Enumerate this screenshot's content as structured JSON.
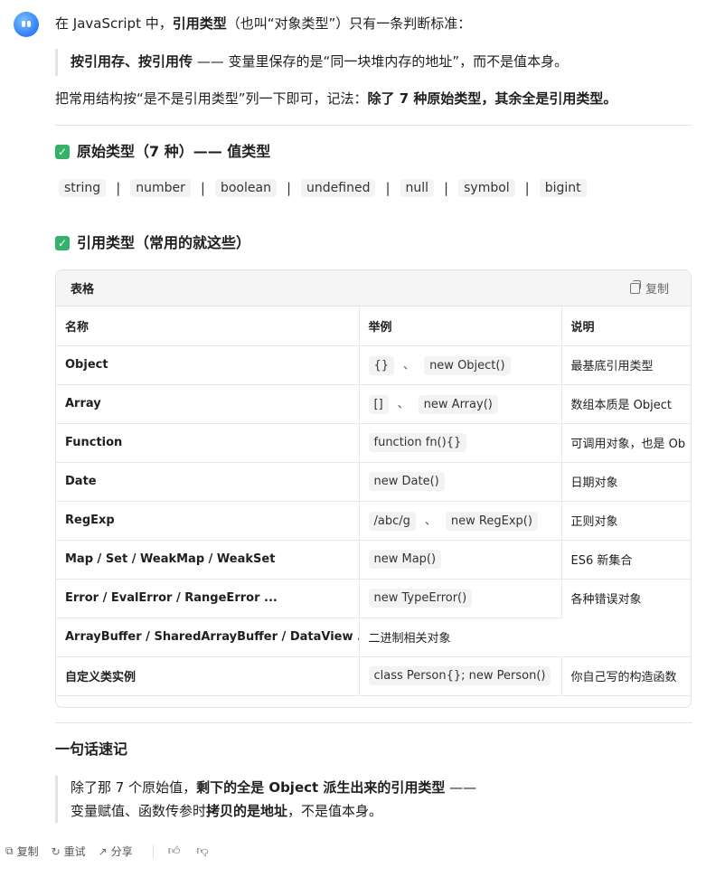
{
  "intro": {
    "prefix": "在 JavaScript 中，",
    "bold": "引用类型",
    "suffix": "（也叫“对象类型”）只有一条判断标准："
  },
  "quote1": {
    "bold": "按引用存、按引用传",
    "text": " —— 变量里保存的是“同一块堆内存的地址”，而不是值本身。"
  },
  "para2": {
    "prefix": "把常用结构按“是不是引用类型”列一下即可，记法：",
    "bold": "除了 7 种原始类型，其余全是引用类型。"
  },
  "section_primitive": {
    "title": "原始类型（7 种）—— 值类型"
  },
  "primitives": [
    "string",
    "number",
    "boolean",
    "undefined",
    "null",
    "symbol",
    "bigint"
  ],
  "section_reference": {
    "title": "引用类型（常用的就这些）"
  },
  "table": {
    "label": "表格",
    "copy_label": "复制",
    "headers": [
      "名称",
      "举例",
      "说明"
    ],
    "rows": [
      {
        "name": "Object",
        "examples": [
          "{}",
          "new Object()"
        ],
        "desc": "最基底引用类型"
      },
      {
        "name": "Array",
        "examples": [
          "[]",
          "new Array()"
        ],
        "desc": "数组本质是 Object"
      },
      {
        "name": "Function",
        "examples": [
          "function fn(){}"
        ],
        "desc": "可调用对象，也是 Ob"
      },
      {
        "name": "Date",
        "examples": [
          "new Date()"
        ],
        "desc": "日期对象"
      },
      {
        "name": "RegExp",
        "examples": [
          "/abc/g",
          "new RegExp()"
        ],
        "desc": "正则对象"
      },
      {
        "name": "Map / Set / WeakMap / WeakSet",
        "examples": [
          "new Map()"
        ],
        "desc": "ES6 新集合"
      },
      {
        "name": "Error / EvalError / RangeError ...",
        "examples": [
          "new TypeError()"
        ],
        "desc": "各种错误对象"
      },
      {
        "name": "ArrayBuffer / SharedArrayBuffer / DataView ...",
        "examples": [],
        "plain_example": "二进制相关对象",
        "desc": ""
      },
      {
        "name": "自定义类实例",
        "examples": [
          "class Person{}; new Person()"
        ],
        "desc": "你自己写的构造函数"
      }
    ]
  },
  "summary": {
    "title": "一句话速记",
    "line1_prefix": "除了那 7 个原始值，",
    "line1_bold": "剩下的全是 Object 派生出来的引用类型",
    "line1_suffix": " ——",
    "line2_prefix": "变量赋值、函数传参时",
    "line2_bold": "拷贝的是地址",
    "line2_suffix": "，不是值本身。"
  },
  "actions": {
    "copy": "复制",
    "retry": "重试",
    "share": "分享"
  },
  "colors": {
    "accent": "#2f7cf6",
    "check": "#34b26a"
  }
}
